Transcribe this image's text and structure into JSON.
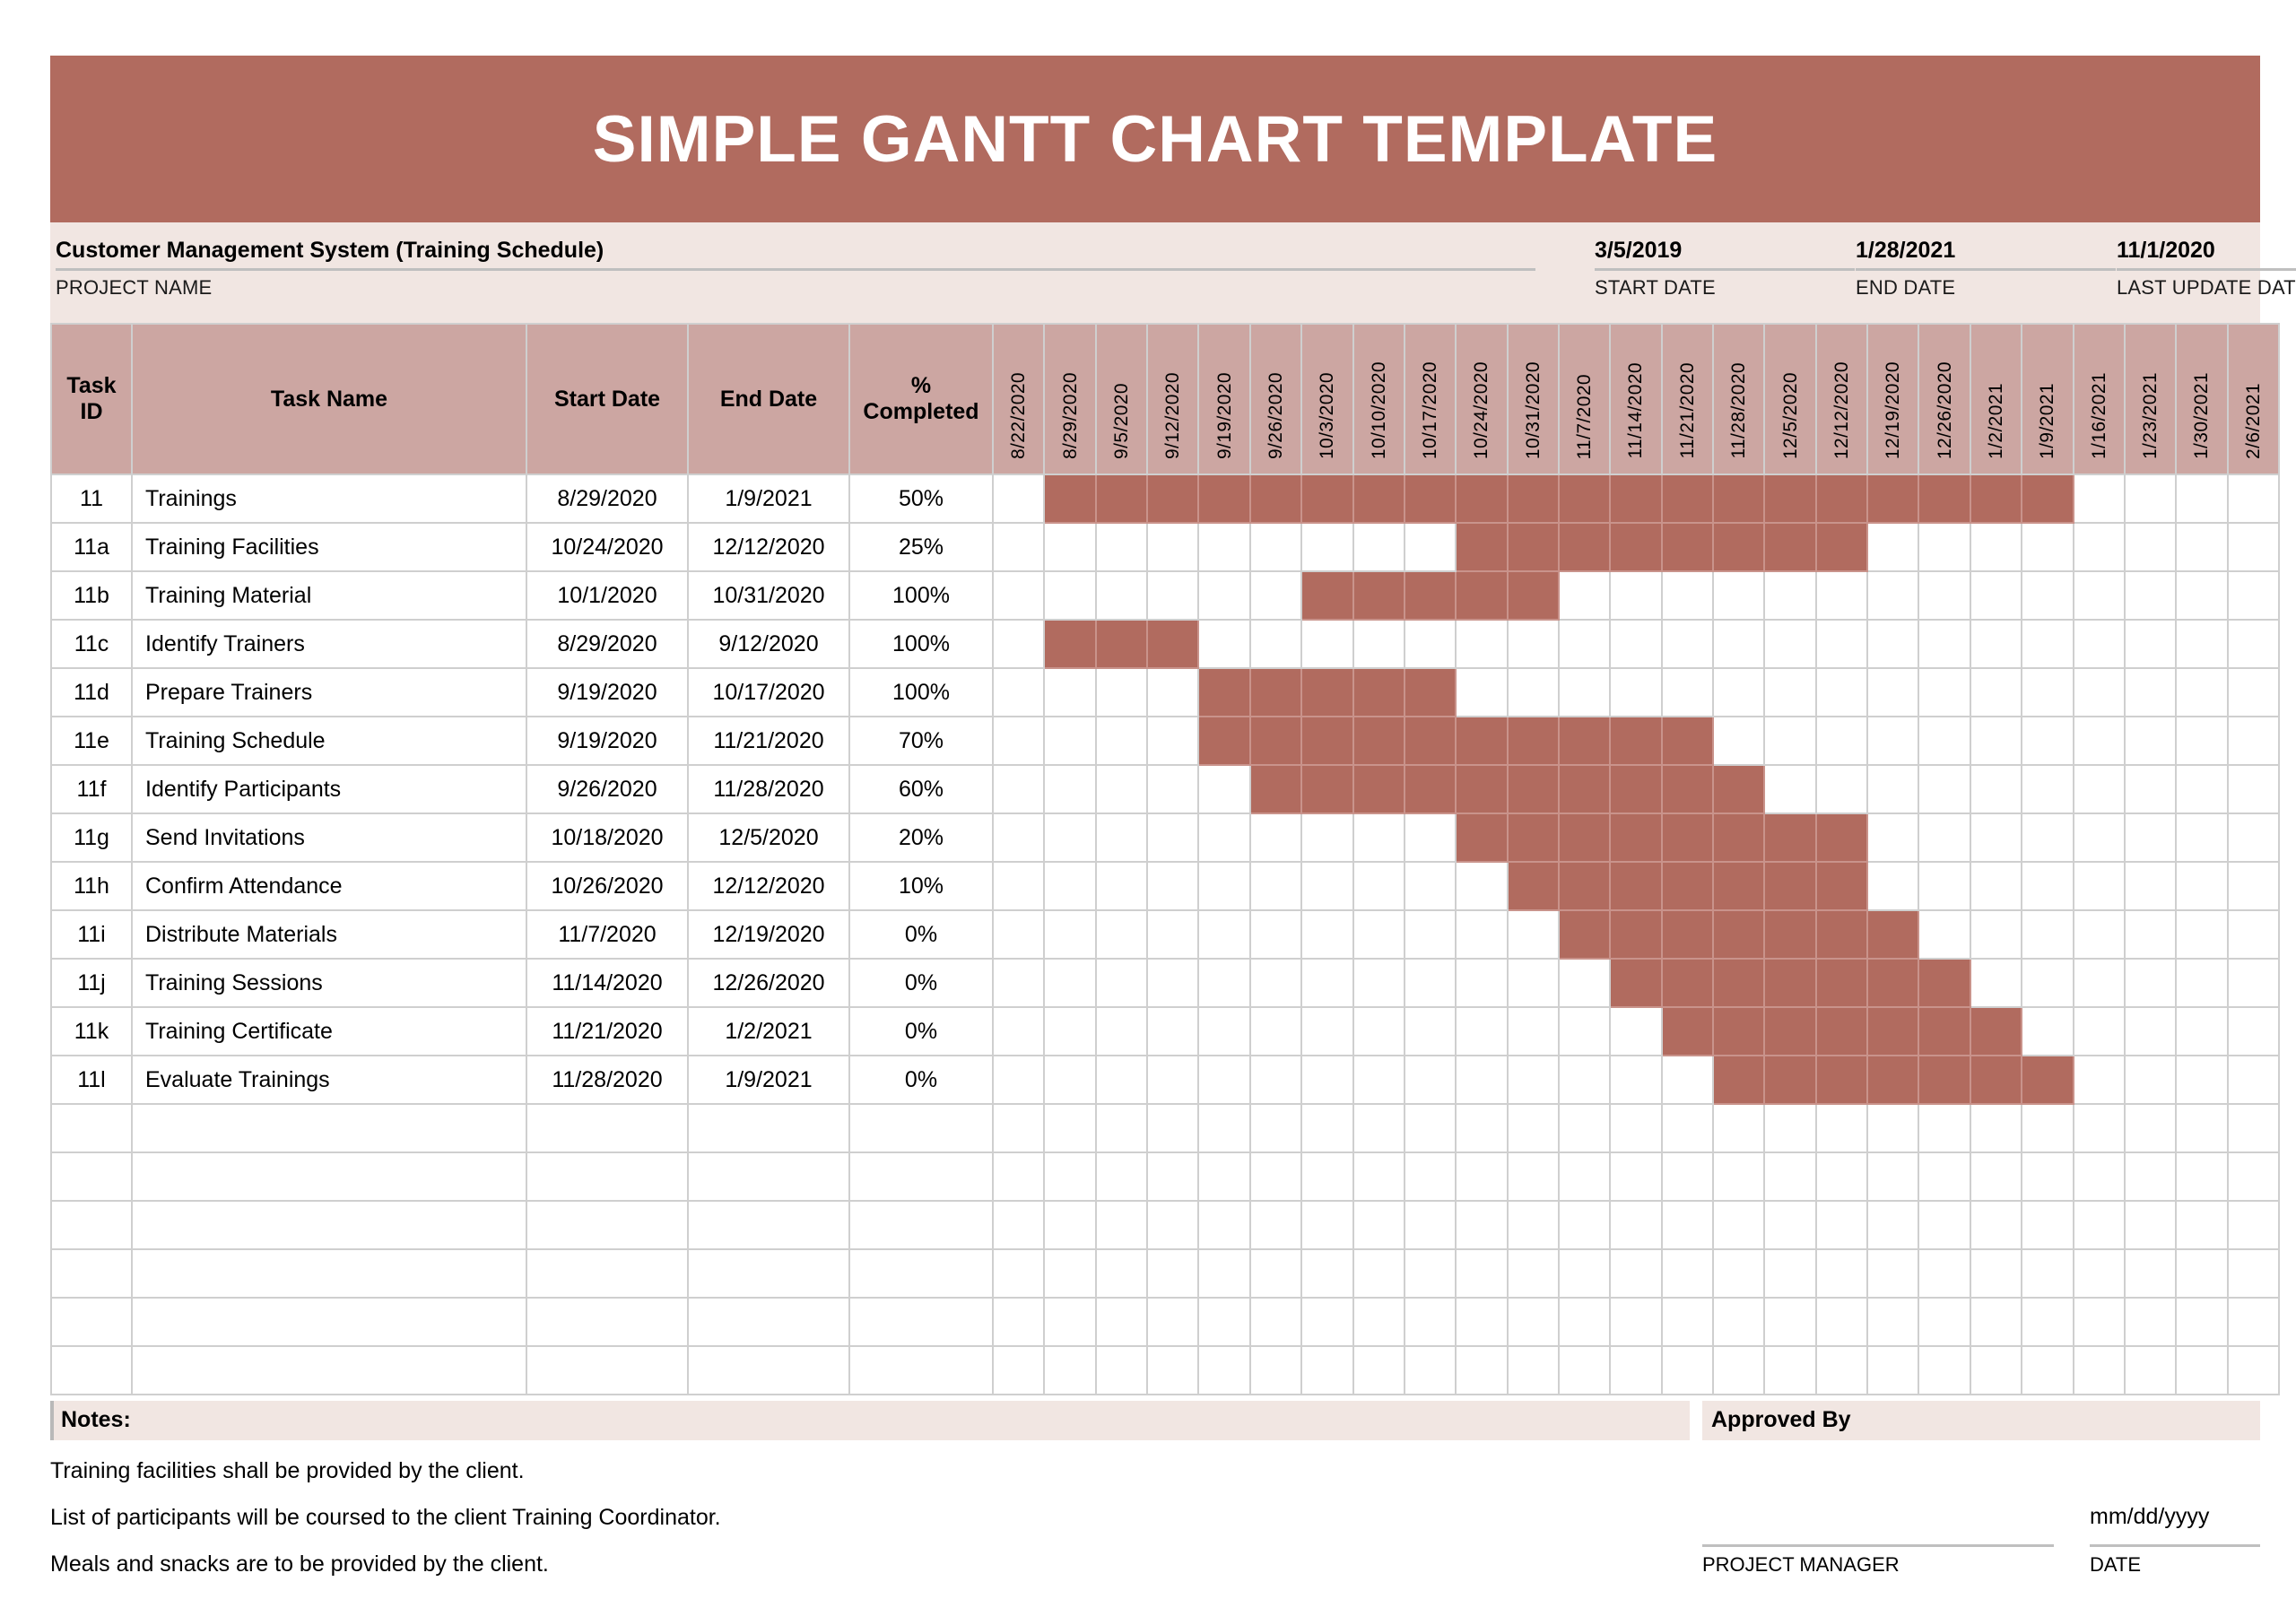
{
  "header": {
    "title": "SIMPLE GANTT CHART TEMPLATE",
    "banner_color": "#B16B5F",
    "strip_color": "#F1E6E2"
  },
  "info": {
    "project_name_value": "Customer Management System (Training Schedule)",
    "project_name_label": "PROJECT NAME",
    "start_date_value": "3/5/2019",
    "start_date_label": "START DATE",
    "end_date_value": "1/28/2021",
    "end_date_label": "END DATE",
    "last_update_value": "11/1/2020",
    "last_update_label": "LAST UPDATE DATE"
  },
  "table": {
    "columns": [
      "Task ID",
      "Task Name",
      "Start Date",
      "End Date",
      "% Completed"
    ],
    "col_task_id_line1": "Task",
    "col_task_id_line2": "ID",
    "col_task_name": "Task Name",
    "col_start_date": "Start Date",
    "col_end_date": "End Date",
    "col_pct_line1": "%",
    "col_pct_line2": "Completed",
    "timeline_headers": [
      "8/22/2020",
      "8/29/2020",
      "9/5/2020",
      "9/12/2020",
      "9/19/2020",
      "9/26/2020",
      "10/3/2020",
      "10/10/2020",
      "10/17/2020",
      "10/24/2020",
      "10/31/2020",
      "11/7/2020",
      "11/14/2020",
      "11/21/2020",
      "11/28/2020",
      "12/5/2020",
      "12/12/2020",
      "12/19/2020",
      "12/26/2020",
      "1/2/2021",
      "1/9/2021",
      "1/16/2021",
      "1/23/2021",
      "1/30/2021",
      "2/6/2021"
    ],
    "empty_row_count": 6
  },
  "chart_data": {
    "type": "bar",
    "title": "SIMPLE GANTT CHART TEMPLATE",
    "xlabel": "",
    "ylabel": "",
    "grid": true,
    "bar_color": "#B16B5F",
    "timeline_start": "8/22/2020",
    "timeline_end": "2/6/2021",
    "timeline_interval_days": 7,
    "timeline_columns": 25,
    "tasks": [
      {
        "task_id": "11",
        "task_name": "Trainings",
        "start_date": "8/29/2020",
        "end_date": "1/9/2021",
        "pct_completed": "50%",
        "pct_value": 50,
        "bar_start_col": 2,
        "bar_end_col": 21
      },
      {
        "task_id": "11a",
        "task_name": "Training Facilities",
        "start_date": "10/24/2020",
        "end_date": "12/12/2020",
        "pct_completed": "25%",
        "pct_value": 25,
        "bar_start_col": 10,
        "bar_end_col": 17
      },
      {
        "task_id": "11b",
        "task_name": "Training Material",
        "start_date": "10/1/2020",
        "end_date": "10/31/2020",
        "pct_completed": "100%",
        "pct_value": 100,
        "bar_start_col": 7,
        "bar_end_col": 11
      },
      {
        "task_id": "11c",
        "task_name": "Identify Trainers",
        "start_date": "8/29/2020",
        "end_date": "9/12/2020",
        "pct_completed": "100%",
        "pct_value": 100,
        "bar_start_col": 2,
        "bar_end_col": 4
      },
      {
        "task_id": "11d",
        "task_name": "Prepare Trainers",
        "start_date": "9/19/2020",
        "end_date": "10/17/2020",
        "pct_completed": "100%",
        "pct_value": 100,
        "bar_start_col": 5,
        "bar_end_col": 9
      },
      {
        "task_id": "11e",
        "task_name": "Training Schedule",
        "start_date": "9/19/2020",
        "end_date": "11/21/2020",
        "pct_completed": "70%",
        "pct_value": 70,
        "bar_start_col": 5,
        "bar_end_col": 14
      },
      {
        "task_id": "11f",
        "task_name": "Identify Participants",
        "start_date": "9/26/2020",
        "end_date": "11/28/2020",
        "pct_completed": "60%",
        "pct_value": 60,
        "bar_start_col": 6,
        "bar_end_col": 15
      },
      {
        "task_id": "11g",
        "task_name": "Send Invitations",
        "start_date": "10/18/2020",
        "end_date": "12/5/2020",
        "pct_completed": "20%",
        "pct_value": 20,
        "bar_start_col": 10,
        "bar_end_col": 17
      },
      {
        "task_id": "11h",
        "task_name": "Confirm Attendance",
        "start_date": "10/26/2020",
        "end_date": "12/12/2020",
        "pct_completed": "10%",
        "pct_value": 10,
        "bar_start_col": 11,
        "bar_end_col": 17
      },
      {
        "task_id": "11i",
        "task_name": "Distribute Materials",
        "start_date": "11/7/2020",
        "end_date": "12/19/2020",
        "pct_completed": "0%",
        "pct_value": 0,
        "bar_start_col": 12,
        "bar_end_col": 18
      },
      {
        "task_id": "11j",
        "task_name": "Training Sessions",
        "start_date": "11/14/2020",
        "end_date": "12/26/2020",
        "pct_completed": "0%",
        "pct_value": 0,
        "bar_start_col": 13,
        "bar_end_col": 19
      },
      {
        "task_id": "11k",
        "task_name": "Training Certificate",
        "start_date": "11/21/2020",
        "end_date": "1/2/2021",
        "pct_completed": "0%",
        "pct_value": 0,
        "bar_start_col": 14,
        "bar_end_col": 20
      },
      {
        "task_id": "11l",
        "task_name": "Evaluate Trainings",
        "start_date": "11/28/2020",
        "end_date": "1/9/2021",
        "pct_completed": "0%",
        "pct_value": 0,
        "bar_start_col": 15,
        "bar_end_col": 21
      }
    ]
  },
  "footer": {
    "notes_title": "Notes:",
    "notes": [
      "Training facilities shall be provided by the client.",
      "List of participants will be coursed to the client Training Coordinator.",
      "Meals and snacks are to be provided by the client."
    ],
    "approved_by_title": "Approved By",
    "project_manager_value": "",
    "project_manager_label": "PROJECT MANAGER",
    "date_value": "mm/dd/yyyy",
    "date_label": "DATE"
  }
}
